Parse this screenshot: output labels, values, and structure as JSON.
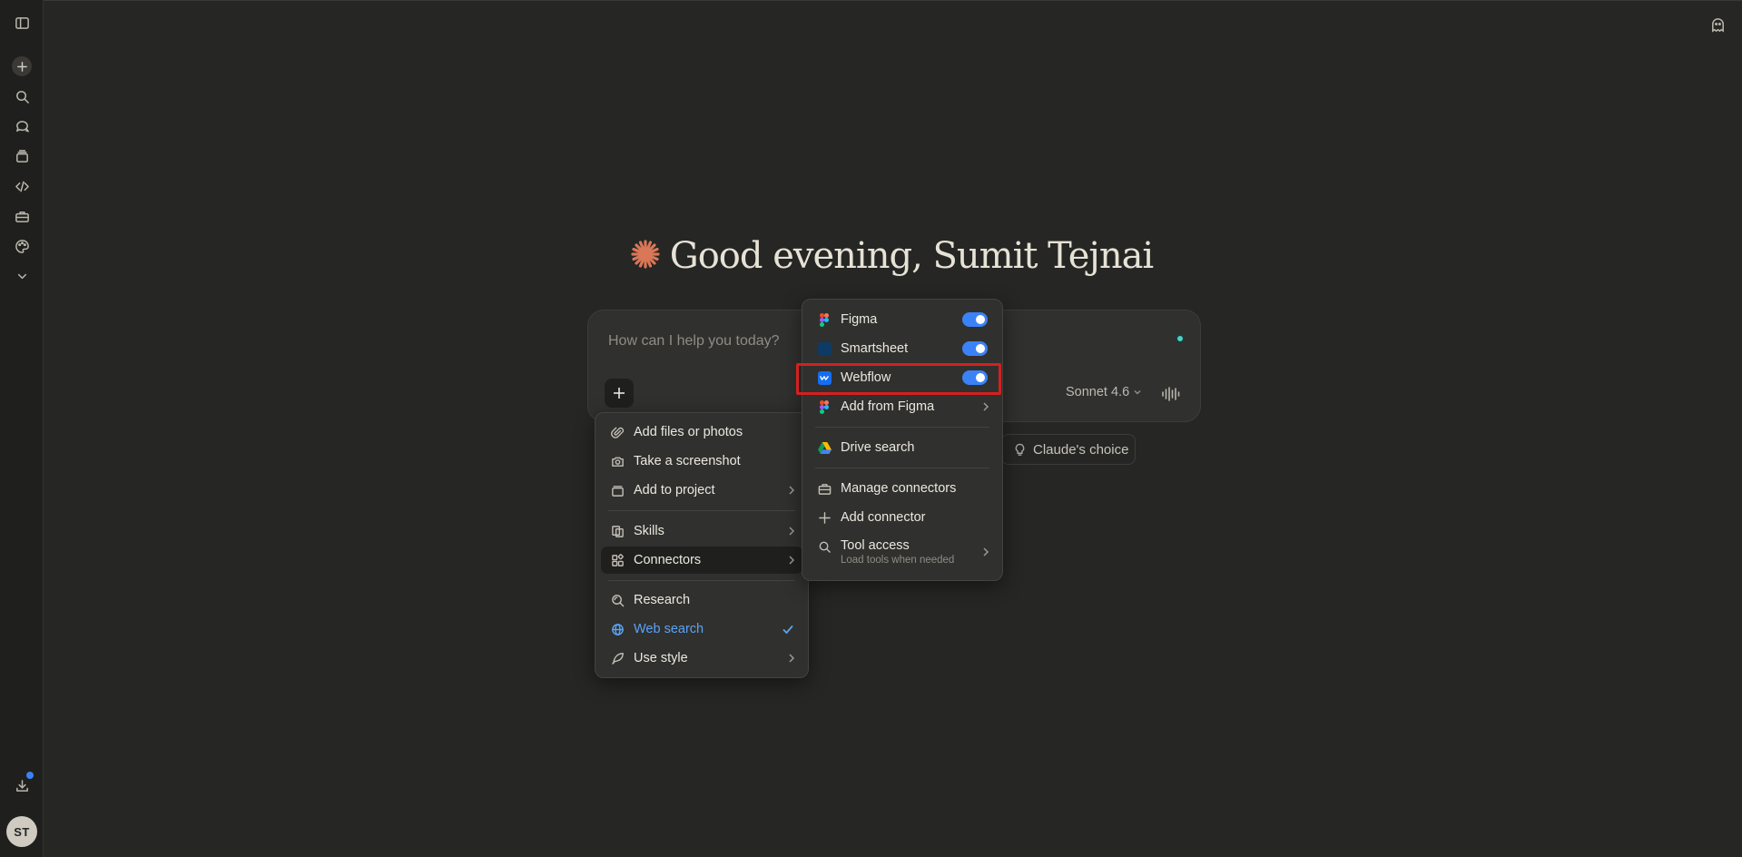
{
  "sidebar": {
    "icons": [
      "sidebar-toggle-icon",
      "plus-icon",
      "search-icon",
      "chats-icon",
      "projects-icon",
      "code-icon",
      "toolbox-icon",
      "palette-icon",
      "chevron-down-icon",
      "download-icon"
    ],
    "avatar_initials": "ST"
  },
  "greeting": {
    "text": "Good evening, Sumit Tejnai"
  },
  "composer": {
    "placeholder": "How can I help you today?",
    "model": "Sonnet 4.6"
  },
  "suggestion_chip": {
    "label": "Claude's choice"
  },
  "plus_menu": {
    "items": [
      {
        "label": "Add files or photos",
        "icon": "paperclip-icon"
      },
      {
        "label": "Take a screenshot",
        "icon": "camera-icon"
      },
      {
        "label": "Add to project",
        "icon": "project-icon",
        "has_submenu": true
      },
      {
        "label": "Skills",
        "icon": "skills-icon",
        "has_submenu": true
      },
      {
        "label": "Connectors",
        "icon": "connectors-icon",
        "has_submenu": true,
        "active": true
      },
      {
        "label": "Research",
        "icon": "research-icon"
      },
      {
        "label": "Web search",
        "icon": "globe-icon",
        "checked": true,
        "color": "#5ba3f5"
      },
      {
        "label": "Use style",
        "icon": "quill-icon",
        "has_submenu": true
      }
    ]
  },
  "connectors_menu": {
    "items": [
      {
        "label": "Figma",
        "icon": "figma-icon",
        "enabled": true
      },
      {
        "label": "Smartsheet",
        "icon": "smartsheet-icon",
        "enabled": true
      },
      {
        "label": "Webflow",
        "icon": "webflow-icon",
        "enabled": true,
        "highlighted": true
      },
      {
        "label": "Add from Figma",
        "icon": "figma-icon",
        "has_submenu": true
      },
      {
        "label": "Drive search",
        "icon": "google-drive-icon"
      },
      {
        "label": "Manage connectors",
        "icon": "toolbox-icon"
      },
      {
        "label": "Add connector",
        "icon": "plus-icon"
      },
      {
        "label": "Tool access",
        "description": "Load tools when needed",
        "icon": "search-icon",
        "has_submenu": true
      }
    ]
  },
  "colors": {
    "background": "#262624",
    "accent_orange": "#d97757",
    "toggle_blue": "#3b82f6",
    "highlight_red": "#d42020"
  }
}
